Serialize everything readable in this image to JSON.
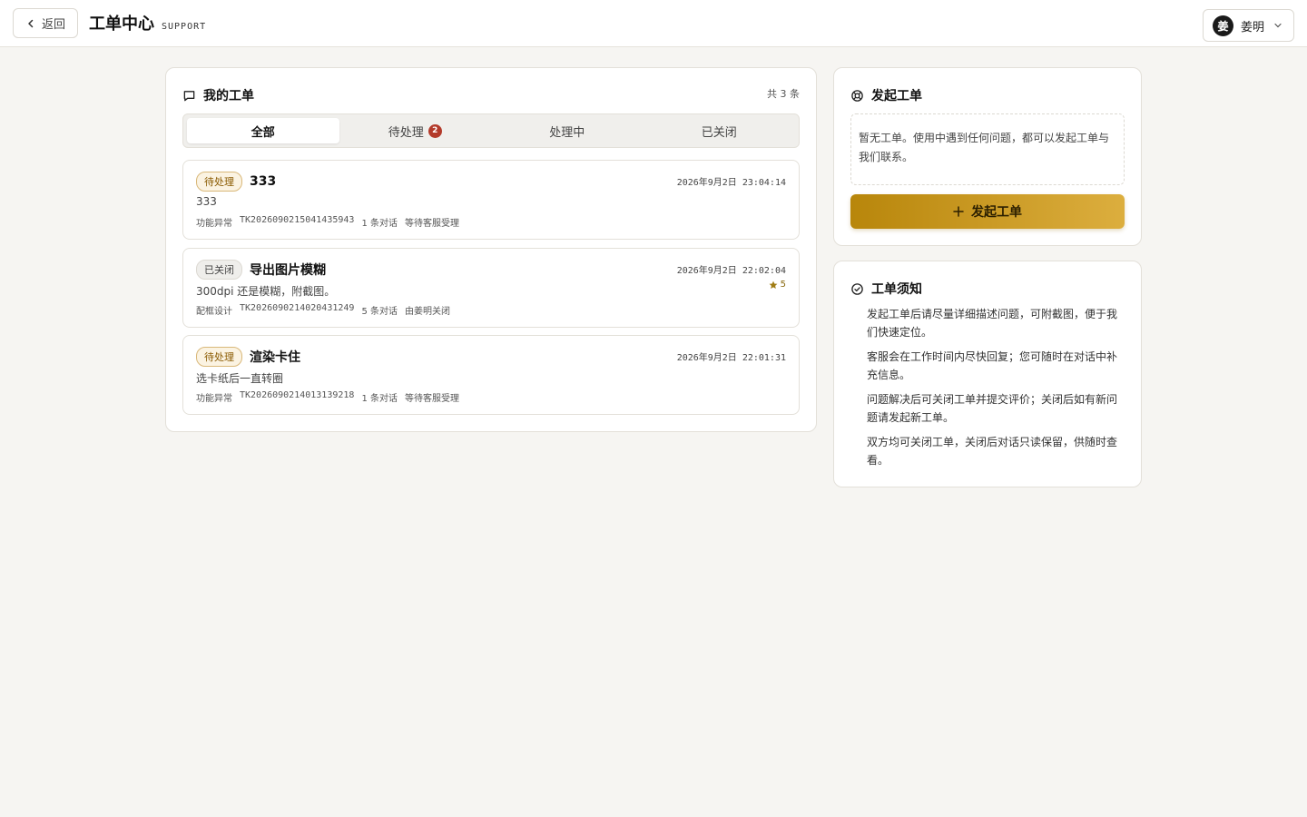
{
  "header": {
    "back_label": "返回",
    "title": "工单中心",
    "subtitle": "SUPPORT",
    "user_initial": "姜",
    "user_name": "姜明"
  },
  "tickets_panel": {
    "title": "我的工单",
    "count_text": "共 3 条",
    "tabs": [
      {
        "label": "全部",
        "active": true
      },
      {
        "label": "待处理",
        "badge": "2"
      },
      {
        "label": "处理中"
      },
      {
        "label": "已关闭"
      }
    ],
    "tickets": [
      {
        "status": "待处理",
        "title": "333",
        "time": "2026年9月2日 23:04:14",
        "desc": "333",
        "category": "功能异常",
        "id": "TK2026090215041435943",
        "replies": "1 条对话",
        "state_text": "等待客服受理"
      },
      {
        "status": "已关闭",
        "title": "导出图片模糊",
        "time": "2026年9月2日 22:02:04",
        "desc": "300dpi 还是模糊，附截图。",
        "category": "配框设计",
        "id": "TK2026090214020431249",
        "replies": "5 条对话",
        "state_text": "由姜明关闭",
        "rating": "5"
      },
      {
        "status": "待处理",
        "title": "渲染卡住",
        "time": "2026年9月2日 22:01:31",
        "desc": "选卡纸后一直转圈",
        "category": "功能异常",
        "id": "TK2026090214013139218",
        "replies": "1 条对话",
        "state_text": "等待客服受理"
      }
    ]
  },
  "new_ticket": {
    "title": "发起工单",
    "empty_text": "暂无工单。使用中遇到任何问题，都可以发起工单与我们联系。",
    "button_label": "发起工单"
  },
  "notice": {
    "title": "工单须知",
    "items": [
      "发起工单后请尽量详细描述问题，可附截图，便于我们快速定位。",
      "客服会在工作时间内尽快回复；您可随时在对话中补充信息。",
      "问题解决后可关闭工单并提交评价；关闭后如有新问题请发起新工单。",
      "双方均可关闭工单，关闭后对话只读保留，供随时查看。"
    ]
  },
  "colors": {
    "accent_start": "#b8860b",
    "accent_end": "#dcae3e",
    "badge_red": "#b33a2a",
    "background": "#f6f5f2"
  }
}
